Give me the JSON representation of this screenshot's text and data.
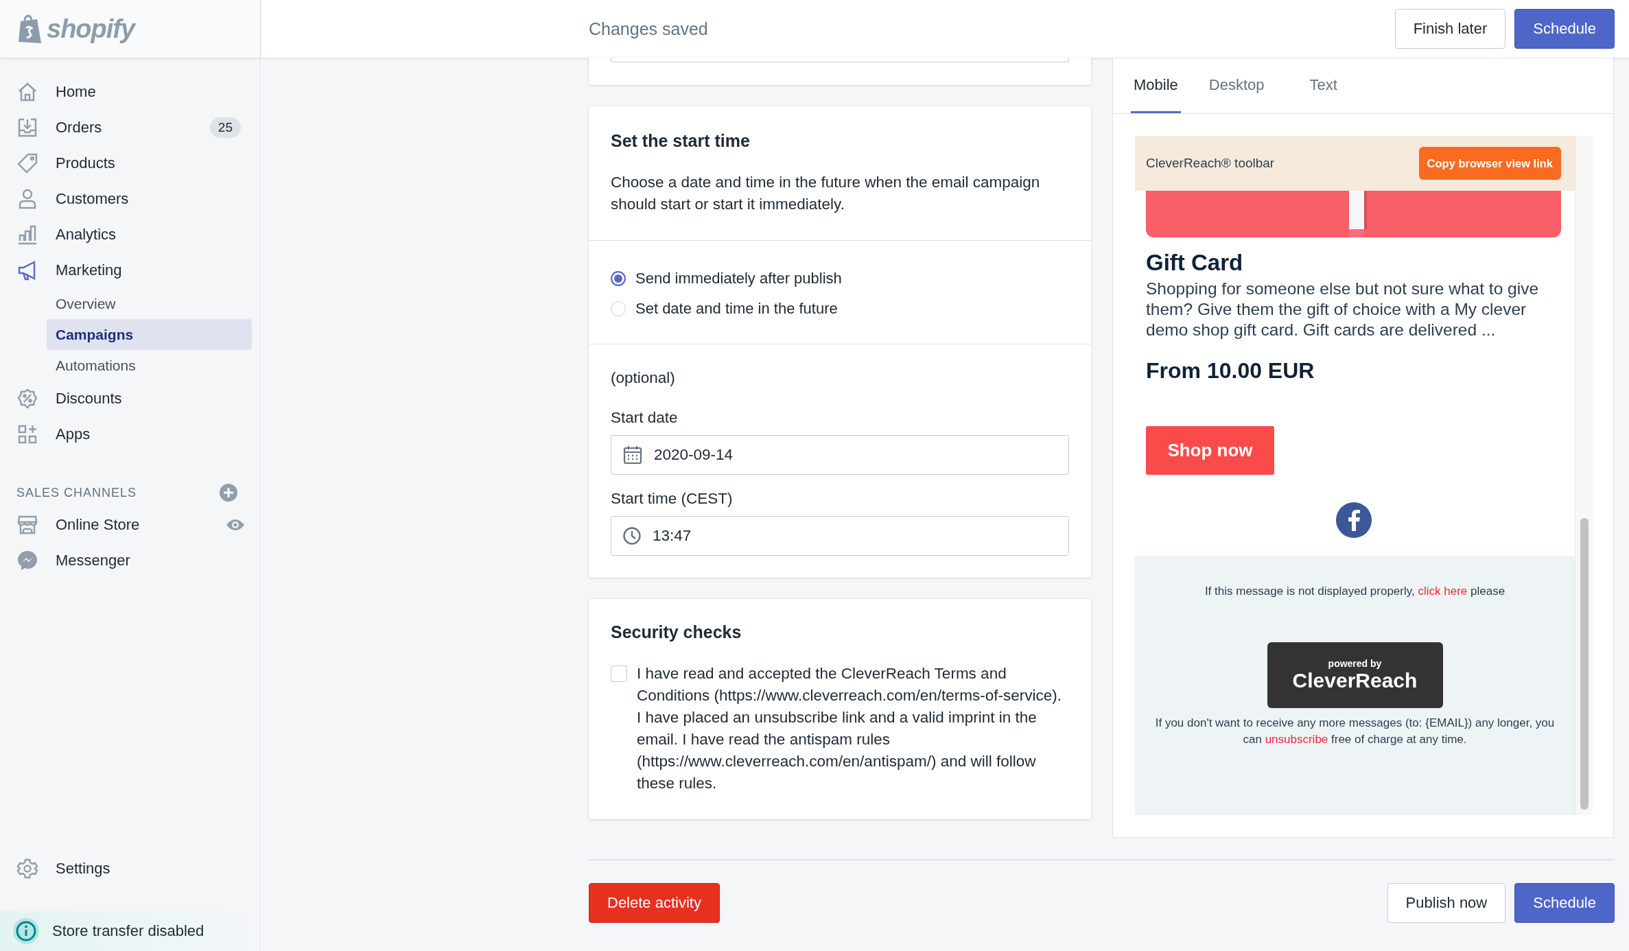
{
  "sidebar": {
    "logo": "shopify",
    "nav": [
      {
        "label": "Home",
        "selected": false
      },
      {
        "label": "Orders",
        "selected": false,
        "badge": "25"
      },
      {
        "label": "Products",
        "selected": false
      },
      {
        "label": "Customers",
        "selected": false
      },
      {
        "label": "Analytics",
        "selected": false
      },
      {
        "label": "Marketing",
        "selected": true,
        "children": [
          {
            "label": "Overview",
            "selected": false
          },
          {
            "label": "Campaigns",
            "selected": true
          },
          {
            "label": "Automations",
            "selected": false
          }
        ]
      },
      {
        "label": "Discounts",
        "selected": false
      },
      {
        "label": "Apps",
        "selected": false
      }
    ],
    "sales_channels": {
      "heading": "SALES CHANNELS",
      "items": [
        {
          "label": "Online Store"
        },
        {
          "label": "Messenger"
        }
      ]
    },
    "settings": "Settings",
    "notice": "Store transfer disabled"
  },
  "top_bar": {
    "status": "Changes saved",
    "buttons": [
      {
        "label": "Finish later",
        "kind": "secondary"
      },
      {
        "label": "Schedule",
        "kind": "primary"
      }
    ]
  },
  "start_time": {
    "title": "Set the start time",
    "description": "Choose a date and time in the future when the email campaign should start or start it immediately.",
    "options": [
      {
        "label": "Send immediately after publish",
        "selected": true
      },
      {
        "label": "Set date and time in the future",
        "selected": false
      }
    ],
    "optional": "(optional)",
    "fields": [
      {
        "label": "Start date",
        "value": "2020-09-14",
        "kind": "date"
      },
      {
        "label": "Start time (CEST)",
        "value": "13:47",
        "kind": "time"
      }
    ]
  },
  "security": {
    "title": "Security checks",
    "checked": false,
    "text": "I have read and accepted the CleverReach Terms and Conditions (https://www.cleverreach.com/en/terms-of-service). I have placed an unsubscribe link and a valid imprint in the email. I have read the antispam rules (https://www.cleverreach.com/en/antispam/) and will follow these rules."
  },
  "footer": {
    "buttons": [
      {
        "label": "Delete activity",
        "kind": "destructive"
      },
      {
        "label": "Publish now",
        "kind": "secondary"
      },
      {
        "label": "Schedule",
        "kind": "primary"
      }
    ]
  },
  "preview": {
    "tabs": [
      {
        "label": "Mobile",
        "selected": true
      },
      {
        "label": "Desktop",
        "selected": false
      },
      {
        "label": "Text",
        "selected": false
      }
    ],
    "email": {
      "toolbar": "CleverReach® toolbar",
      "toolbar_button": "Copy browser view link",
      "product_title": "Gift Card",
      "description": "Shopping for someone else but not sure what to give them? Give them the gift of choice with a My clever demo shop gift card. Gift cards are delivered ...",
      "price": "From 10.00 EUR",
      "cta": "Shop now",
      "display_note": {
        "before": "If this message is not displayed properly,",
        "link": "click here",
        "after": "please"
      },
      "powered_by": {
        "caption": "powered by",
        "brand": "CleverReach"
      },
      "unsubscribe_note": {
        "before": "If you don't want to receive any more messages (to: {EMAIL}) any longer, you can",
        "link": "unsubscribe",
        "after": "free of charge at any time."
      }
    }
  }
}
